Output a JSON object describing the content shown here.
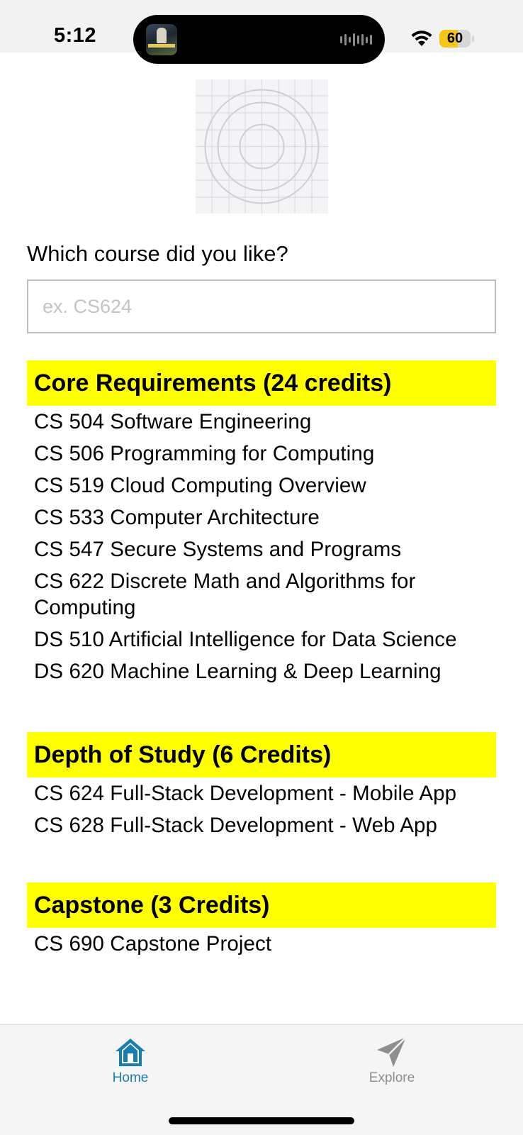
{
  "status_bar": {
    "time": "5:12",
    "battery_level": "60",
    "battery_fraction": 0.6,
    "battery_color": "#f5c518"
  },
  "now_playing": {
    "icon": "album-art-icon",
    "waveform_icon": "audio-waveform-icon"
  },
  "placeholder_image": {
    "icon": "image-placeholder-icon"
  },
  "form": {
    "prompt": "Which course did you like?",
    "input_value": "",
    "input_placeholder": "ex. CS624"
  },
  "sections": [
    {
      "header": "Core Requirements (24 credits)",
      "courses": [
        "CS 504 Software Engineering",
        "CS 506 Programming for Computing",
        "CS 519 Cloud Computing Overview",
        "CS 533 Computer Architecture",
        "CS 547 Secure Systems and Programs",
        "CS 622 Discrete Math and Algorithms for Computing",
        "DS 510 Artificial Intelligence for Data Science",
        "DS 620 Machine Learning & Deep Learning"
      ]
    },
    {
      "header": "Depth of Study (6 Credits)",
      "courses": [
        "CS 624 Full-Stack Development - Mobile App",
        "CS 628 Full-Stack Development - Web App"
      ]
    },
    {
      "header": "Capstone (3 Credits)",
      "courses": [
        "CS 690 Capstone Project"
      ]
    }
  ],
  "tab_bar": {
    "tabs": [
      {
        "label": "Home",
        "icon": "home-icon",
        "active": true
      },
      {
        "label": "Explore",
        "icon": "paper-plane-icon",
        "active": false
      }
    ]
  },
  "colors": {
    "section_header_bg": "#ffff00",
    "active_tab": "#1a7db0",
    "inactive_tab": "#8e8e8e"
  }
}
